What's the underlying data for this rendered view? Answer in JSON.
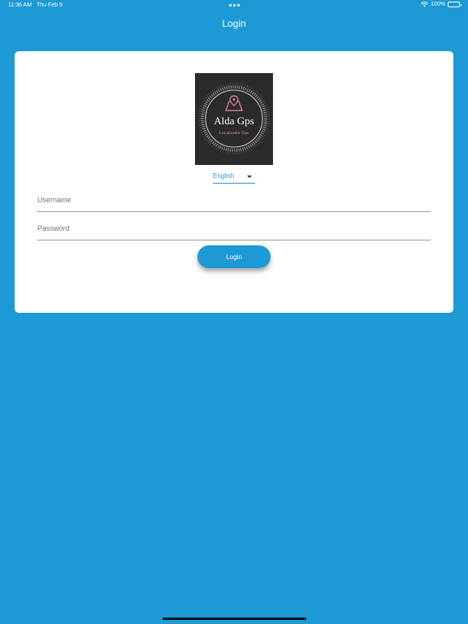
{
  "status_bar": {
    "time": "11:36 AM",
    "date": "Thu Feb 9",
    "battery": "100%",
    "icons": [
      "wifi-icon",
      "battery-icon"
    ]
  },
  "nav": {
    "title": "Login"
  },
  "logo": {
    "name": "Alda Gps",
    "tagline": "Localizador Gps",
    "icon": "map-pin-icon",
    "colors": {
      "background": "#2b2b2b",
      "accent": "#e88aa6"
    }
  },
  "language": {
    "selected": "English"
  },
  "form": {
    "username_placeholder": "Username",
    "password_placeholder": "Password",
    "login_label": "Login"
  },
  "colors": {
    "primary": "#1d9ad6",
    "card": "#ffffff"
  }
}
